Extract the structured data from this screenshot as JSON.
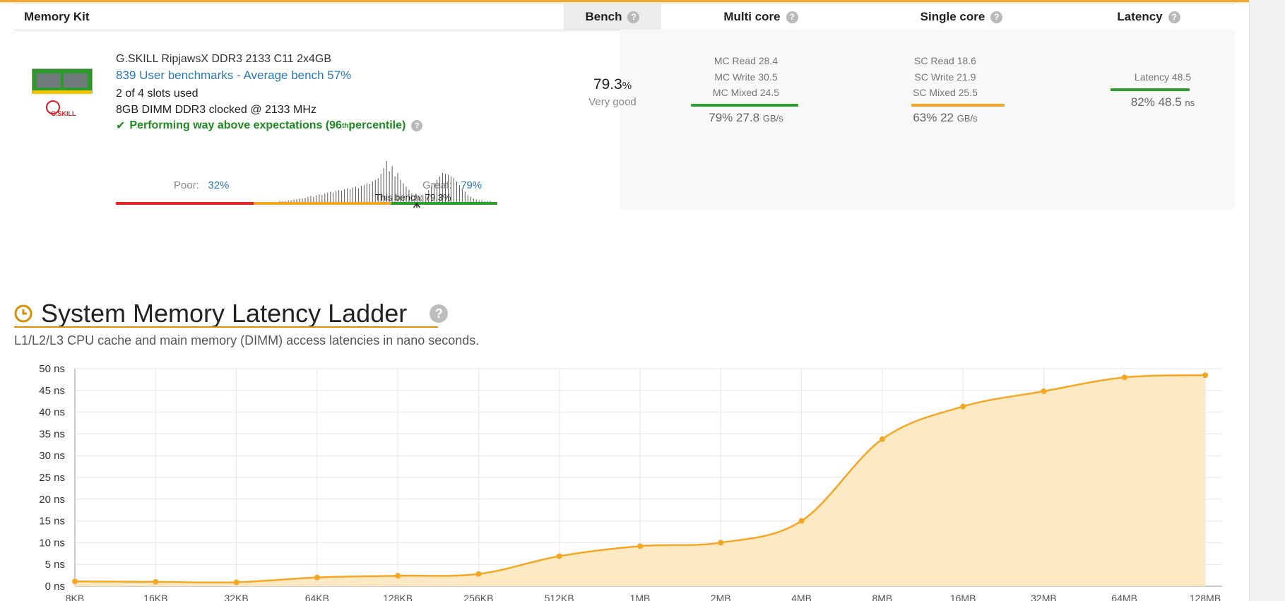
{
  "table": {
    "headers": {
      "kit": "Memory Kit",
      "bench": "Bench",
      "multi": "Multi core",
      "single": "Single core",
      "latency": "Latency"
    },
    "help_glyph": "?"
  },
  "kit": {
    "name": "G.SKILL RipjawsX DDR3 2133 C11 2x4GB",
    "benchmarks_link": "839 User benchmarks - Average bench 57%",
    "slots": "2 of 4 slots used",
    "dimm": "8GB DIMM DDR3 clocked @ 2133 MHz",
    "performance_prefix": "Performing way above expectations (96",
    "performance_sup": "th",
    "performance_suffix": " percentile)",
    "brand_label": "G.SKILL",
    "poor_label": "Poor:",
    "poor_value": "32%",
    "great_label": "Great:",
    "great_value": "79%",
    "this_bench": "This bench: 79.3%",
    "colors": {
      "poor": "#e8262a",
      "average": "#f5a623",
      "great": "#2e9e2e"
    },
    "distribution": [
      0,
      0,
      0,
      0,
      0,
      0,
      0,
      0,
      0,
      0,
      0,
      0,
      0,
      0,
      0,
      0,
      0,
      0,
      0,
      0,
      0,
      0,
      0,
      0,
      0,
      0,
      0,
      0,
      0,
      0,
      0,
      0,
      0,
      0,
      0,
      0,
      0,
      0,
      0,
      0,
      0,
      0,
      0,
      0,
      0,
      0,
      0,
      0,
      0,
      0,
      0,
      0,
      0,
      0,
      0,
      0,
      0,
      0,
      1,
      1,
      1,
      2,
      2,
      3,
      3,
      4,
      4,
      5,
      6,
      7,
      6,
      8,
      9,
      8,
      10,
      11,
      12,
      11,
      13,
      14,
      13,
      15,
      16,
      15,
      17,
      18,
      16,
      19,
      20,
      22,
      21,
      24,
      26,
      28,
      33,
      40,
      48,
      36,
      42,
      30,
      34,
      26,
      22,
      18,
      14,
      10,
      8,
      6,
      6,
      8,
      10,
      14,
      18,
      22,
      26,
      30,
      34,
      33,
      32,
      30,
      28,
      24,
      20,
      16,
      12,
      8,
      6,
      4,
      3,
      2,
      2,
      1,
      1,
      1,
      0,
      0
    ]
  },
  "bench": {
    "value": "79.3",
    "unit": "%",
    "rating": "Very good"
  },
  "multi": {
    "read": "MC Read 28.4",
    "write": "MC Write 30.5",
    "mixed": "MC Mixed 24.5",
    "result": "79% 27.8",
    "unit": "GB/s",
    "color": "#2e9e2e"
  },
  "single": {
    "read": "SC Read 18.6",
    "write": "SC Write 21.9",
    "mixed": "SC Mixed 25.5",
    "result": "63% 22",
    "unit": "GB/s",
    "color": "#f5a623"
  },
  "latency": {
    "label": "Latency 48.5",
    "result": "82% 48.5",
    "unit": "ns",
    "color": "#2e9e2e"
  },
  "section": {
    "title": "System Memory Latency Ladder",
    "subtitle": "L1/L2/L3 CPU cache and main memory (DIMM) access latencies in nano seconds.",
    "help_glyph": "?"
  },
  "chart_data": {
    "type": "area",
    "x": [
      "8KB",
      "16KB",
      "32KB",
      "64KB",
      "128KB",
      "256KB",
      "512KB",
      "1MB",
      "2MB",
      "4MB",
      "8MB",
      "16MB",
      "32MB",
      "64MB",
      "128MB"
    ],
    "values": [
      1.1,
      1.0,
      0.9,
      2.0,
      2.4,
      2.8,
      6.9,
      9.2,
      10.0,
      15.0,
      33.8,
      41.3,
      44.8,
      48.0,
      48.5
    ],
    "y_ticks": [
      "0 ns",
      "5 ns",
      "10 ns",
      "15 ns",
      "20 ns",
      "25 ns",
      "30 ns",
      "35 ns",
      "40 ns",
      "45 ns",
      "50 ns"
    ],
    "ylim": [
      0,
      50
    ],
    "grid": true,
    "colors": {
      "line": "#f5a623",
      "fill": "#fde9c4",
      "point": "#f5a623"
    }
  }
}
